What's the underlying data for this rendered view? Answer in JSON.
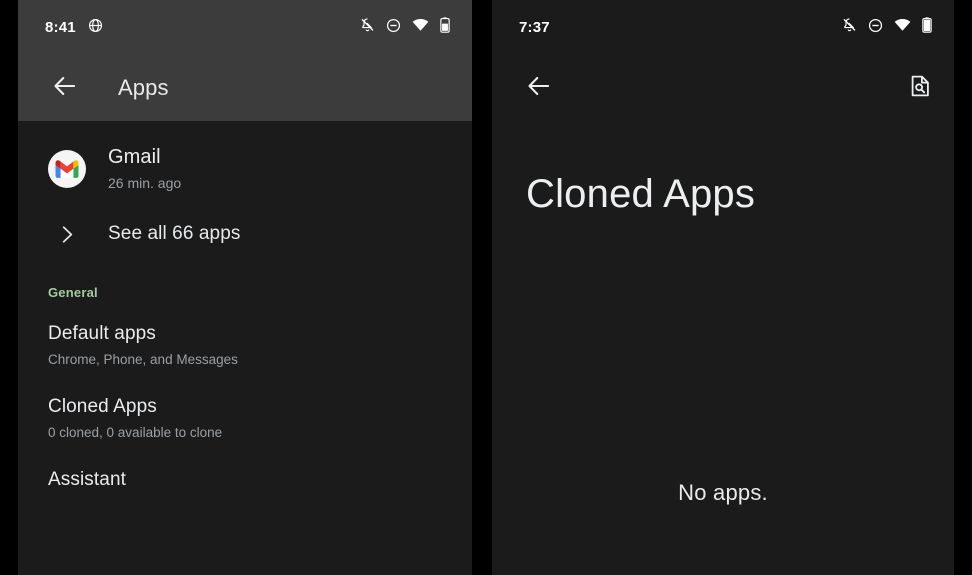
{
  "left_screen": {
    "status_bar": {
      "clock": "8:41",
      "left_icons": [
        {
          "name": "globe-icon",
          "label": "globe"
        }
      ],
      "right_icons": [
        {
          "name": "notifications-off-icon",
          "label": "notifications off"
        },
        {
          "name": "do-not-disturb-icon",
          "label": "do not disturb"
        },
        {
          "name": "wifi-icon",
          "label": "wifi"
        },
        {
          "name": "battery-icon",
          "label": "battery"
        }
      ]
    },
    "app_bar": {
      "back_icon": "arrow-back-icon",
      "title": "Apps"
    },
    "recent_app": {
      "icon": "gmail-icon",
      "name": "Gmail",
      "subtitle": "26 min. ago"
    },
    "see_all": {
      "icon": "chevron-right-icon",
      "label": "See all 66 apps"
    },
    "section_header": "General",
    "items": [
      {
        "title": "Default apps",
        "subtitle": "Chrome, Phone, and Messages"
      },
      {
        "title": "Cloned Apps",
        "subtitle": "0 cloned, 0 available to clone"
      },
      {
        "title": "Assistant",
        "subtitle": ""
      }
    ]
  },
  "right_screen": {
    "status_bar": {
      "clock": "7:37",
      "right_icons": [
        {
          "name": "notifications-off-icon",
          "label": "notifications off"
        },
        {
          "name": "do-not-disturb-icon",
          "label": "do not disturb"
        },
        {
          "name": "wifi-icon",
          "label": "wifi"
        },
        {
          "name": "battery-icon",
          "label": "battery"
        }
      ]
    },
    "app_bar": {
      "back_icon": "arrow-back-icon",
      "action_icon": "document-search-icon"
    },
    "title": "Cloned Apps",
    "empty_state": "No apps."
  },
  "colors": {
    "background": "#000000",
    "surface": "#1b1b1b",
    "app_bar_shaded": "#3c3c3c",
    "accent_green": "#a2cba0",
    "primary_text": "#eceff1",
    "secondary_text": "#9aa0a6"
  }
}
